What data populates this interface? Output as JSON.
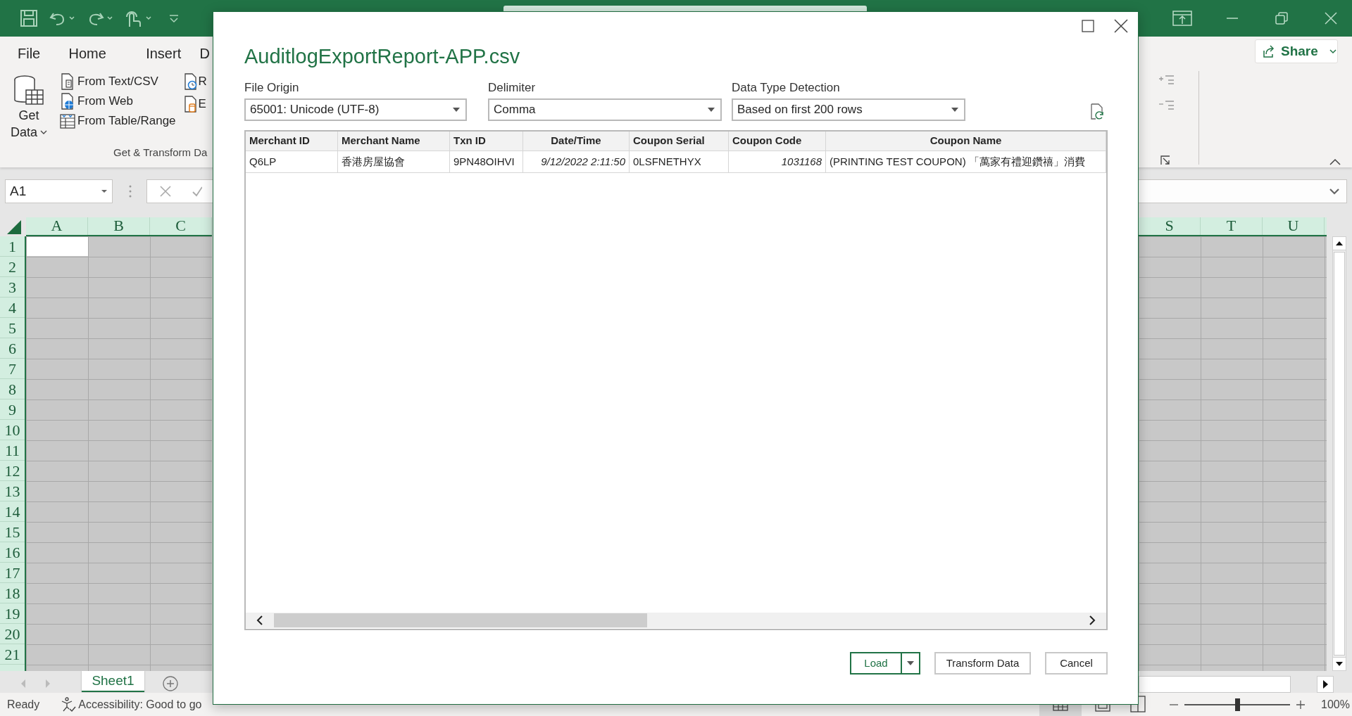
{
  "ribbon": {
    "tabs": [
      {
        "label": "File",
        "selected": false
      },
      {
        "label": "Home",
        "selected": false
      },
      {
        "label": "Insert",
        "selected": false
      },
      {
        "label": "D",
        "selected": false
      }
    ],
    "get_data": {
      "lines": [
        "Get",
        "Data"
      ]
    },
    "commands": [
      {
        "label": "From Text/CSV"
      },
      {
        "label": "From Web"
      },
      {
        "label": "From Table/Range"
      }
    ],
    "commands_cut": [
      {
        "label": "R"
      },
      {
        "label": "E"
      }
    ],
    "group_label": "Get & Transform Da",
    "share": "Share"
  },
  "formula_bar": {
    "name_box": "A1"
  },
  "sheet": {
    "columns_left": [
      "A",
      "B",
      "C"
    ],
    "columns_right": [
      "S",
      "T",
      "U"
    ],
    "rows": [
      "1",
      "2",
      "3",
      "4",
      "5",
      "6",
      "7",
      "8",
      "9",
      "10",
      "11",
      "12",
      "13",
      "14",
      "15",
      "16",
      "17",
      "18",
      "19",
      "20",
      "21"
    ]
  },
  "sheet_tabs": [
    {
      "label": "Sheet1",
      "selected": true
    }
  ],
  "status_bar": {
    "ready": "Ready",
    "accessibility": "Accessibility: Good to go",
    "zoom_slider": {
      "level": 0.5
    },
    "zoom": "100%"
  },
  "dialog": {
    "title": "AuditlogExportReport-APP.csv",
    "fields": [
      {
        "label": "File Origin",
        "value": "65001: Unicode (UTF-8)"
      },
      {
        "label": "Delimiter",
        "value": "Comma"
      },
      {
        "label": "Data Type Detection",
        "value": "Based on first 200 rows"
      }
    ],
    "table": {
      "columns": [
        "Merchant ID",
        "Merchant Name",
        "Txn ID",
        "Date/Time",
        "Coupon Serial",
        "Coupon Code",
        "Coupon Name"
      ],
      "rows": [
        [
          {
            "text": "Q6LP",
            "kind": "text"
          },
          {
            "text": "香港房屋協會",
            "kind": "text"
          },
          {
            "text": "9PN48OIHVI",
            "kind": "text"
          },
          {
            "text": "9/12/2022 2:11:50",
            "kind": "date"
          },
          {
            "text": "0LSFNETHYX",
            "kind": "text"
          },
          {
            "text": "1031168",
            "kind": "number"
          },
          {
            "text": "(PRINTING TEST COUPON) 「萬家有禮迎鑽禧」消費",
            "kind": "text"
          }
        ]
      ]
    },
    "buttons": {
      "load": "Load",
      "transform": "Transform Data",
      "cancel": "Cancel"
    }
  }
}
